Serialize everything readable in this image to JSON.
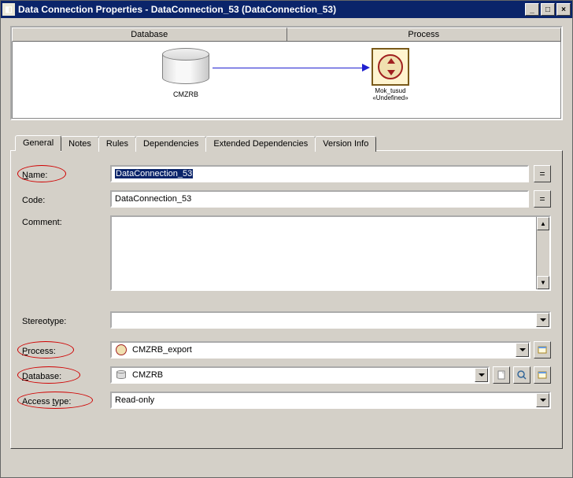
{
  "window": {
    "title": "Data Connection Properties - DataConnection_53 (DataConnection_53)"
  },
  "diagram": {
    "header_left": "Database",
    "header_right": "Process",
    "db_label": "CMZRB",
    "proc_label1": "Mok_tusud",
    "proc_label2": "«Undefined»"
  },
  "tabs": [
    "General",
    "Notes",
    "Rules",
    "Dependencies",
    "Extended Dependencies",
    "Version Info"
  ],
  "form": {
    "name_label": "Name:",
    "name_value": "DataConnection_53",
    "code_label": "Code:",
    "code_value": "DataConnection_53",
    "comment_label": "Comment:",
    "comment_value": "",
    "stereotype_label": "Stereotype:",
    "stereotype_value": "",
    "process_label": "Process:",
    "process_value": "CMZRB_export",
    "database_label": "Database:",
    "database_value": "CMZRB",
    "accesstype_label": "Access type:",
    "accesstype_value": "Read-only",
    "eq_button": "="
  }
}
